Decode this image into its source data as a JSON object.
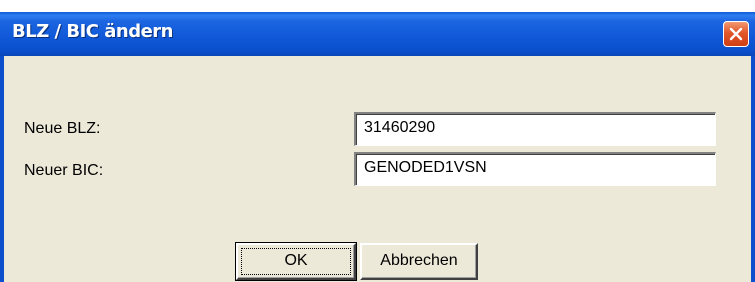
{
  "window": {
    "title": "BLZ / BIC ändern",
    "close_icon": "close-icon"
  },
  "form": {
    "blz_label": "Neue BLZ:",
    "blz_value": "31460290",
    "bic_label": "Neuer BIC:",
    "bic_value": "GENODED1VSN"
  },
  "buttons": {
    "ok_label": "OK",
    "cancel_label": "Abbrechen"
  },
  "colors": {
    "titlebar": "#0b4fcc",
    "dialog_background": "#ece9d8",
    "close_button": "#e2572a"
  }
}
